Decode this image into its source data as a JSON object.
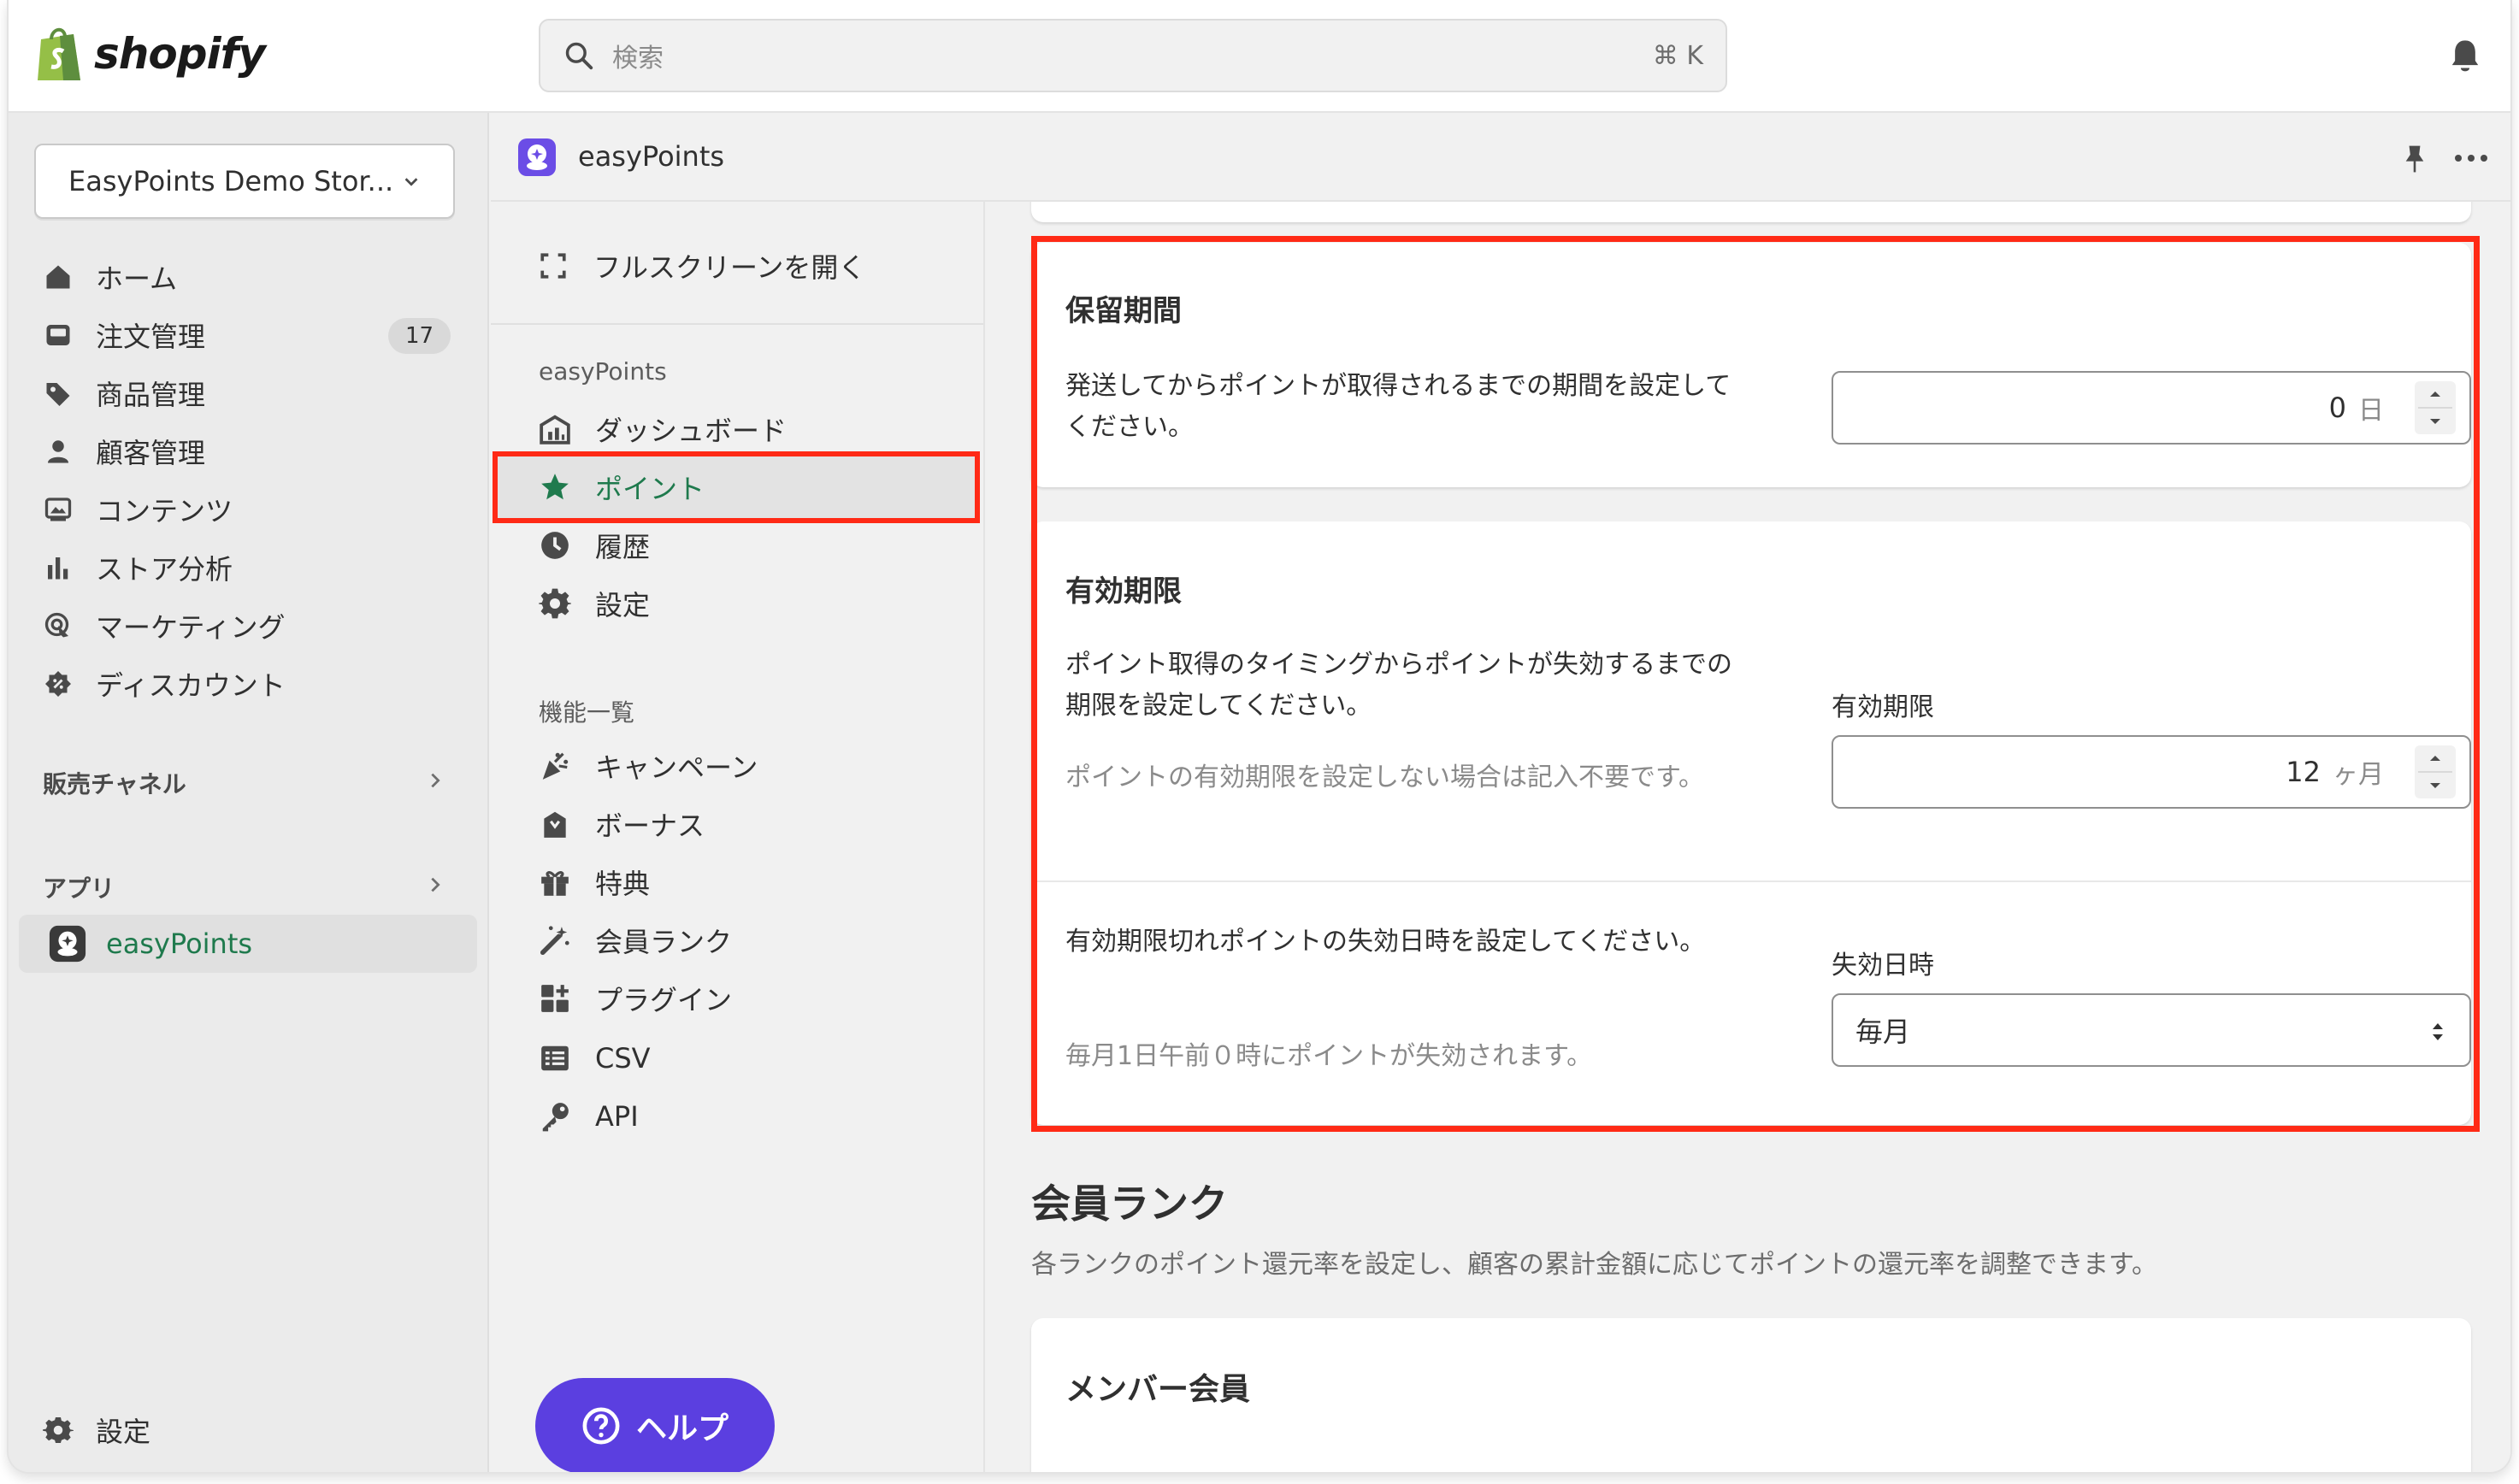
{
  "brand": {
    "name": "shopify",
    "accent": "#1f7a4d",
    "help_color": "#5b3fe0",
    "highlight": "#ff2a16"
  },
  "search": {
    "placeholder": "検索",
    "shortcut": "⌘ K"
  },
  "sidebar": {
    "store_name": "EasyPoints Demo Stor...",
    "items": [
      {
        "label": "ホーム",
        "icon": "home-icon"
      },
      {
        "label": "注文管理",
        "icon": "inbox-icon",
        "badge": "17"
      },
      {
        "label": "商品管理",
        "icon": "tag-icon"
      },
      {
        "label": "顧客管理",
        "icon": "person-icon"
      },
      {
        "label": "コンテンツ",
        "icon": "image-icon"
      },
      {
        "label": "ストア分析",
        "icon": "bar-chart-icon"
      },
      {
        "label": "マーケティング",
        "icon": "target-icon"
      },
      {
        "label": "ディスカウント",
        "icon": "discount-icon"
      }
    ],
    "sales_channels_label": "販売チャネル",
    "apps_label": "アプリ",
    "app_name": "easyPoints",
    "settings_label": "設定"
  },
  "app_header": {
    "title": "easyPoints"
  },
  "app_nav": {
    "fullscreen_label": "フルスクリーンを開く",
    "section1": "easyPoints",
    "items1": [
      {
        "label": "ダッシュボード",
        "icon": "dashboard-icon"
      },
      {
        "label": "ポイント",
        "icon": "star-icon"
      },
      {
        "label": "履歴",
        "icon": "clock-icon"
      },
      {
        "label": "設定",
        "icon": "gear-icon"
      }
    ],
    "section2": "機能一覧",
    "items2": [
      {
        "label": "キャンペーン",
        "icon": "confetti-icon"
      },
      {
        "label": "ボーナス",
        "icon": "bag-icon"
      },
      {
        "label": "特典",
        "icon": "gift-icon"
      },
      {
        "label": "会員ランク",
        "icon": "magic-wand-icon"
      },
      {
        "label": "プラグイン",
        "icon": "apps-icon"
      },
      {
        "label": "CSV",
        "icon": "list-icon"
      },
      {
        "label": "API",
        "icon": "key-icon"
      }
    ],
    "help_label": "ヘルプ"
  },
  "holding": {
    "title": "保留期間",
    "desc": "発送してからポイントが取得されるまでの期間を設定してください。",
    "value": "0",
    "unit": "日"
  },
  "expiry": {
    "title": "有効期限",
    "desc": "ポイント取得のタイミングからポイントが失効するまでの期限を設定してください。",
    "note": "ポイントの有効期限を設定しない場合は記入不要です。",
    "field_label": "有効期限",
    "value": "12",
    "unit": "ヶ月",
    "expire_desc": "有効期限切れポイントの失効日時を設定してください。",
    "expire_note": "毎月1日午前０時にポイントが失効されます。",
    "expire_label": "失効日時",
    "expire_value": "毎月"
  },
  "rank": {
    "heading": "会員ランク",
    "sub": "各ランクのポイント還元率を設定し、顧客の累計金額に応じてポイントの還元率を調整できます。",
    "card_title": "メンバー会員"
  }
}
